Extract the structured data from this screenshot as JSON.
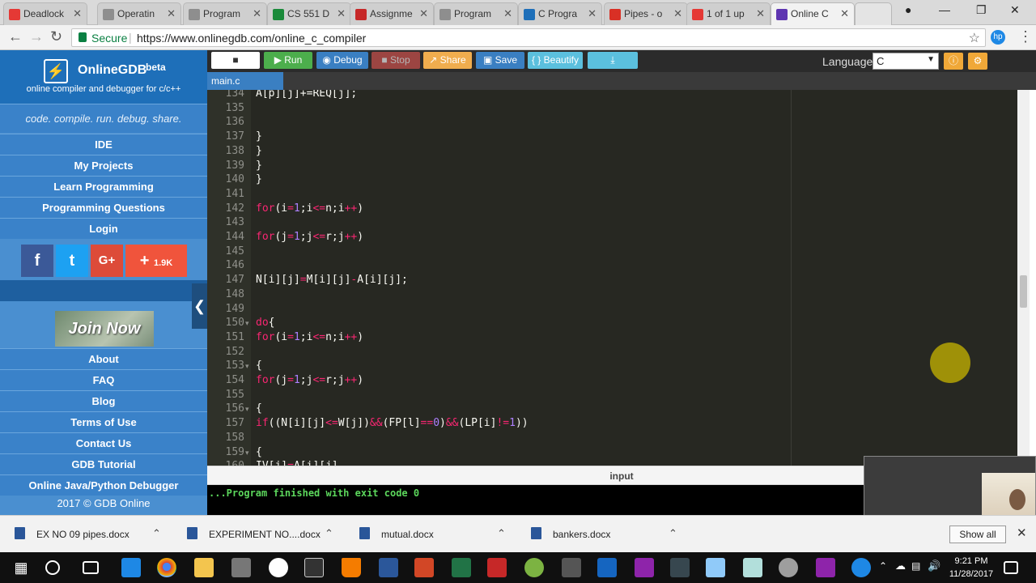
{
  "browser": {
    "tabs": [
      {
        "label": "Deadlock",
        "color": "#e53935"
      },
      {
        "label": "Operatin",
        "color": "#8e8e8e"
      },
      {
        "label": "Program",
        "color": "#8e8e8e"
      },
      {
        "label": "CS 551 D",
        "color": "#1a8a3a"
      },
      {
        "label": "Assignme",
        "color": "#c62828"
      },
      {
        "label": "Program",
        "color": "#8e8e8e"
      },
      {
        "label": "C Progra",
        "color": "#1e6fb9"
      },
      {
        "label": "Pipes - o",
        "color": "#d93025"
      },
      {
        "label": "1 of 1 up",
        "color": "#e53935"
      },
      {
        "label": "Online C",
        "color": "#5e35b1"
      }
    ],
    "secure_label": "Secure",
    "url": "https://www.onlinegdb.com/online_c_compiler"
  },
  "sidebar": {
    "brand": "OnlineGDB",
    "beta": "beta",
    "tagline": "online compiler and debugger for c/c++",
    "slogan": "code. compile. run. debug. share.",
    "nav_top": [
      "IDE",
      "My Projects",
      "Learn Programming",
      "Programming Questions",
      "Login"
    ],
    "social": {
      "facebook": "f",
      "twitter": "t",
      "google": "G+",
      "share_count": "1.9K"
    },
    "join_now": "Join Now",
    "nav_bottom": [
      "About",
      "FAQ",
      "Blog",
      "Terms of Use",
      "Contact Us",
      "GDB Tutorial",
      "Online Java/Python Debugger"
    ],
    "copyright": "2017 © GDB Online"
  },
  "toolbar": {
    "run": "Run",
    "debug": "Debug",
    "stop": "Stop",
    "share": "Share",
    "save": "Save",
    "beautify": "{ } Beautify",
    "language_label": "Language",
    "language_value": "C"
  },
  "editor": {
    "file_tab": "main.c",
    "lines": [
      {
        "n": "134",
        "fold": false,
        "tokens": [
          [
            "A[p][j]+=REQ[j];",
            ""
          ]
        ]
      },
      {
        "n": "135",
        "fold": false,
        "tokens": []
      },
      {
        "n": "136",
        "fold": false,
        "tokens": []
      },
      {
        "n": "137",
        "fold": false,
        "tokens": [
          [
            "}",
            ""
          ]
        ]
      },
      {
        "n": "138",
        "fold": false,
        "tokens": [
          [
            "}",
            ""
          ]
        ]
      },
      {
        "n": "139",
        "fold": false,
        "tokens": [
          [
            "}",
            ""
          ]
        ]
      },
      {
        "n": "140",
        "fold": false,
        "tokens": [
          [
            "}",
            ""
          ]
        ]
      },
      {
        "n": "141",
        "fold": false,
        "tokens": []
      },
      {
        "n": "142",
        "fold": false,
        "tokens": [
          [
            "for",
            "kw"
          ],
          [
            "(i",
            ""
          ],
          [
            "=",
            "kw"
          ],
          [
            "1",
            "num"
          ],
          [
            ";i",
            ""
          ],
          [
            "<=",
            "kw"
          ],
          [
            "n;i",
            ""
          ],
          [
            "++",
            "kw"
          ],
          [
            ")",
            ""
          ]
        ]
      },
      {
        "n": "143",
        "fold": false,
        "tokens": []
      },
      {
        "n": "144",
        "fold": false,
        "tokens": [
          [
            "for",
            "kw"
          ],
          [
            "(j",
            ""
          ],
          [
            "=",
            "kw"
          ],
          [
            "1",
            "num"
          ],
          [
            ";j",
            ""
          ],
          [
            "<=",
            "kw"
          ],
          [
            "r;j",
            ""
          ],
          [
            "++",
            "kw"
          ],
          [
            ")",
            ""
          ]
        ]
      },
      {
        "n": "145",
        "fold": false,
        "tokens": []
      },
      {
        "n": "146",
        "fold": false,
        "tokens": []
      },
      {
        "n": "147",
        "fold": false,
        "tokens": [
          [
            "N[i][j]",
            ""
          ],
          [
            "=",
            "kw"
          ],
          [
            "M[i][j]",
            ""
          ],
          [
            "-",
            "kw"
          ],
          [
            "A[i][j];",
            ""
          ]
        ]
      },
      {
        "n": "148",
        "fold": false,
        "tokens": []
      },
      {
        "n": "149",
        "fold": false,
        "tokens": []
      },
      {
        "n": "150",
        "fold": true,
        "tokens": [
          [
            "do",
            "kw"
          ],
          [
            "{",
            ""
          ]
        ]
      },
      {
        "n": "151",
        "fold": false,
        "tokens": [
          [
            "for",
            "kw"
          ],
          [
            "(i",
            ""
          ],
          [
            "=",
            "kw"
          ],
          [
            "1",
            "num"
          ],
          [
            ";i",
            ""
          ],
          [
            "<=",
            "kw"
          ],
          [
            "n;i",
            ""
          ],
          [
            "++",
            "kw"
          ],
          [
            ")",
            ""
          ]
        ]
      },
      {
        "n": "152",
        "fold": false,
        "tokens": []
      },
      {
        "n": "153",
        "fold": true,
        "tokens": [
          [
            "{",
            ""
          ]
        ]
      },
      {
        "n": "154",
        "fold": false,
        "tokens": [
          [
            "for",
            "kw"
          ],
          [
            "(j",
            ""
          ],
          [
            "=",
            "kw"
          ],
          [
            "1",
            "num"
          ],
          [
            ";j",
            ""
          ],
          [
            "<=",
            "kw"
          ],
          [
            "r;j",
            ""
          ],
          [
            "++",
            "kw"
          ],
          [
            ")",
            ""
          ]
        ]
      },
      {
        "n": "155",
        "fold": false,
        "tokens": []
      },
      {
        "n": "156",
        "fold": true,
        "tokens": [
          [
            "{",
            ""
          ]
        ]
      },
      {
        "n": "157",
        "fold": false,
        "tokens": [
          [
            "if",
            "kw"
          ],
          [
            "((N[i][j]",
            ""
          ],
          [
            "<=",
            "kw"
          ],
          [
            "W[j])",
            ""
          ],
          [
            "&&",
            "kw"
          ],
          [
            "(FP[l]",
            ""
          ],
          [
            "==",
            "kw"
          ],
          [
            "0",
            "num"
          ],
          [
            ")",
            ""
          ],
          [
            "&&",
            "kw"
          ],
          [
            "(LP[i]",
            ""
          ],
          [
            "!=",
            "kw"
          ],
          [
            "1",
            "num"
          ],
          [
            "))",
            ""
          ]
        ]
      },
      {
        "n": "158",
        "fold": false,
        "tokens": []
      },
      {
        "n": "159",
        "fold": true,
        "tokens": [
          [
            "{",
            ""
          ]
        ]
      },
      {
        "n": "160",
        "fold": false,
        "tokens": [
          [
            "IV[j]",
            ""
          ],
          [
            "=",
            "kw"
          ],
          [
            "A[i][j]",
            ""
          ]
        ]
      }
    ]
  },
  "output": {
    "input_label": "input",
    "console_text": "...Program finished with exit code 0"
  },
  "downloads": {
    "items": [
      "EX NO 09 pipes.docx",
      "EXPERIMENT NO....docx",
      "mutual.docx",
      "bankers.docx"
    ],
    "show_all": "Show all"
  },
  "taskbar": {
    "time": "9:21 PM",
    "date": "11/28/2017"
  }
}
